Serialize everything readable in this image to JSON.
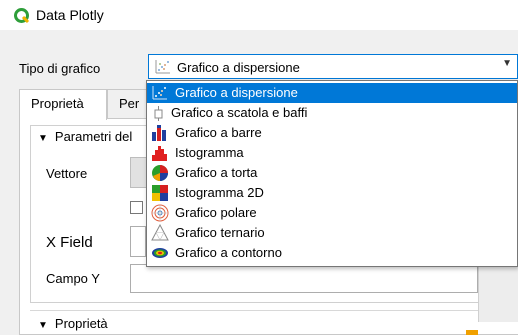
{
  "window": {
    "title": "Data Plotly"
  },
  "plot_type": {
    "label": "Tipo di grafico",
    "selected": "Grafico a dispersione",
    "options": [
      {
        "label": "Grafico a dispersione",
        "icon": "scatter-plot-icon"
      },
      {
        "label": "Grafico a scatola e baffi",
        "icon": "box-plot-icon"
      },
      {
        "label": "Grafico a barre",
        "icon": "bar-chart-icon"
      },
      {
        "label": "Istogramma",
        "icon": "histogram-icon"
      },
      {
        "label": "Grafico a torta",
        "icon": "pie-chart-icon"
      },
      {
        "label": "Istogramma 2D",
        "icon": "histogram-2d-icon"
      },
      {
        "label": "Grafico polare",
        "icon": "polar-plot-icon"
      },
      {
        "label": "Grafico ternario",
        "icon": "ternary-plot-icon"
      },
      {
        "label": "Grafico a contorno",
        "icon": "contour-plot-icon"
      }
    ]
  },
  "tabs": [
    {
      "label": "Proprietà"
    },
    {
      "label": "Per"
    }
  ],
  "params_group": {
    "header": "Parametri del",
    "vector_label": "Vettore",
    "x_label": "X Field",
    "y_label": "Campo Y"
  },
  "properties_section": {
    "header": "Proprietà"
  },
  "colors": {
    "accent": "#0078d7",
    "logo_green": "#2e9e3a"
  }
}
